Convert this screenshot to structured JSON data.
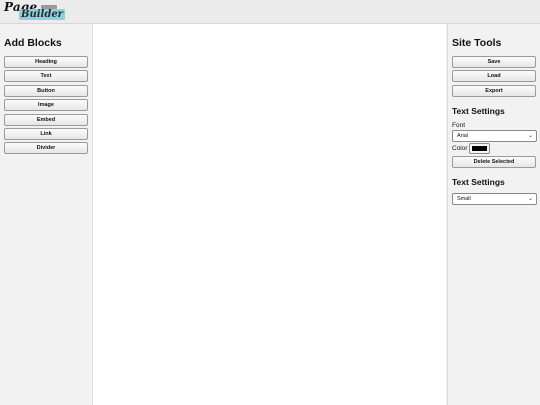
{
  "logo": {
    "line1": "Page",
    "line2": "Builder"
  },
  "left_panel": {
    "title": "Add Blocks",
    "buttons": [
      "Heading",
      "Text",
      "Button",
      "Image",
      "Embed",
      "Link",
      "Divider"
    ]
  },
  "right_panel": {
    "title": "Site Tools",
    "tools": [
      "Save",
      "Load",
      "Export"
    ],
    "text_settings": {
      "title": "Text Settings",
      "font_label": "Font",
      "font_value": "Arial",
      "color_label": "Color",
      "color_value": "#000000",
      "delete_label": "Delete Selected"
    },
    "text_settings_2": {
      "title": "Text Settings",
      "size_value": "Small"
    }
  }
}
